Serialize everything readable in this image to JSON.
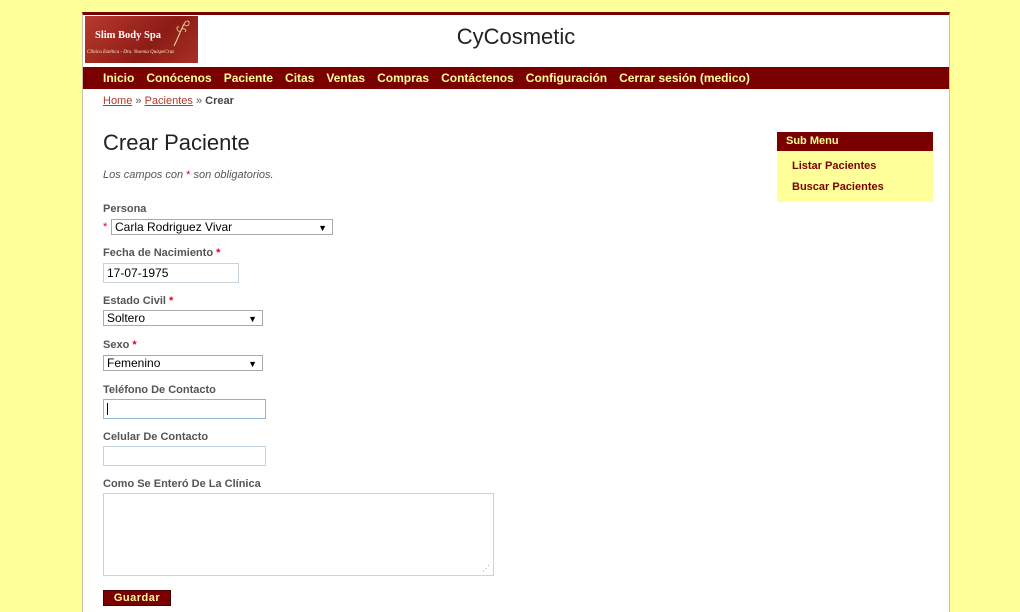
{
  "header": {
    "logo_title": "Slim Body Spa",
    "logo_subtitle": "Clínica Estética - Dra. Yesenia QuispeCruz",
    "site_title": "CyCosmetic"
  },
  "menu": [
    "Inicio",
    "Conócenos",
    "Paciente",
    "Citas",
    "Ventas",
    "Compras",
    "Contáctenos",
    "Configuración",
    "Cerrar sesión (medico)"
  ],
  "breadcrumbs": {
    "home": "Home",
    "sep1": "»",
    "pacientes": "Pacientes",
    "sep2": "»",
    "current": "Crear"
  },
  "form": {
    "title": "Crear Paciente",
    "note_prefix": "Los campos con ",
    "note_star": "*",
    "note_suffix": " son obligatorios.",
    "required_mark": "*",
    "persona": {
      "label": "Persona",
      "value": "Carla Rodriguez Vivar"
    },
    "fecha": {
      "label": "Fecha de Nacimiento",
      "value": "17-07-1975"
    },
    "estado_civil": {
      "label": "Estado Civil",
      "value": "Soltero"
    },
    "sexo": {
      "label": "Sexo",
      "value": "Femenino"
    },
    "telefono": {
      "label": "Teléfono De Contacto",
      "value": ""
    },
    "celular": {
      "label": "Celular De Contacto",
      "value": ""
    },
    "como": {
      "label": "Como Se Enteró De La Clínica",
      "value": ""
    },
    "save_label": "Guardar"
  },
  "submenu": {
    "title": "Sub Menu",
    "items": [
      "Listar Pacientes",
      "Buscar Pacientes"
    ]
  },
  "colors": {
    "brand": "#7a0000",
    "accent_text": "#ffff99",
    "background": "#ffff99",
    "required": "#e0001b"
  }
}
